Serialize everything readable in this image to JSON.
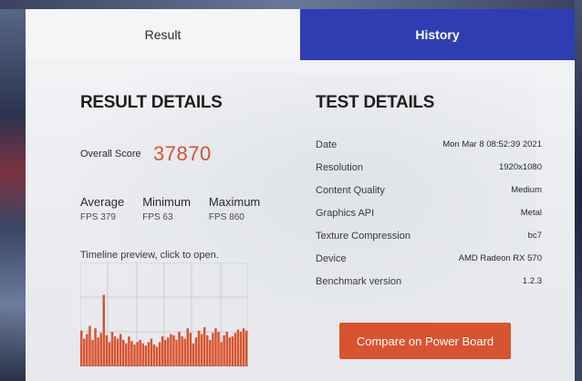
{
  "tabs": [
    {
      "label": "Result",
      "active": true
    },
    {
      "label": "History",
      "active": false
    }
  ],
  "result": {
    "heading": "RESULT DETAILS",
    "overall_score_label": "Overall Score",
    "overall_score": "37870",
    "fps": [
      {
        "label": "Average",
        "value": "FPS 379"
      },
      {
        "label": "Minimum",
        "value": "FPS 63"
      },
      {
        "label": "Maximum",
        "value": "FPS 860"
      }
    ],
    "timeline_label": "Timeline preview, click to open."
  },
  "test": {
    "heading": "TEST DETAILS",
    "rows": [
      {
        "label": "Date",
        "value": "Mon Mar 8 08:52:39 2021"
      },
      {
        "label": "Resolution",
        "value": "1920x1080"
      },
      {
        "label": "Content Quality",
        "value": "Medium"
      },
      {
        "label": "Graphics API",
        "value": "Metal"
      },
      {
        "label": "Texture Compression",
        "value": "bc7"
      },
      {
        "label": "Device",
        "value": "AMD Radeon RX 570"
      },
      {
        "label": "Benchmark version",
        "value": "1.2.3"
      }
    ]
  },
  "compare_button": {
    "label": "Compare on Power Board"
  },
  "colors": {
    "accent": "#d8532f",
    "tab_active_bg": "#2f3db3"
  },
  "chart_data": {
    "type": "bar",
    "ylim": [
      0,
      900
    ],
    "values": [
      310,
      240,
      280,
      350,
      230,
      330,
      250,
      290,
      620,
      270,
      210,
      300,
      260,
      240,
      280,
      230,
      200,
      260,
      220,
      190,
      210,
      230,
      200,
      180,
      210,
      240,
      190,
      170,
      210,
      260,
      230,
      250,
      280,
      270,
      230,
      300,
      260,
      240,
      330,
      290,
      200,
      250,
      310,
      280,
      340,
      270,
      230,
      290,
      330,
      300,
      210,
      270,
      300,
      250,
      260,
      290,
      320,
      300,
      330,
      310
    ]
  }
}
